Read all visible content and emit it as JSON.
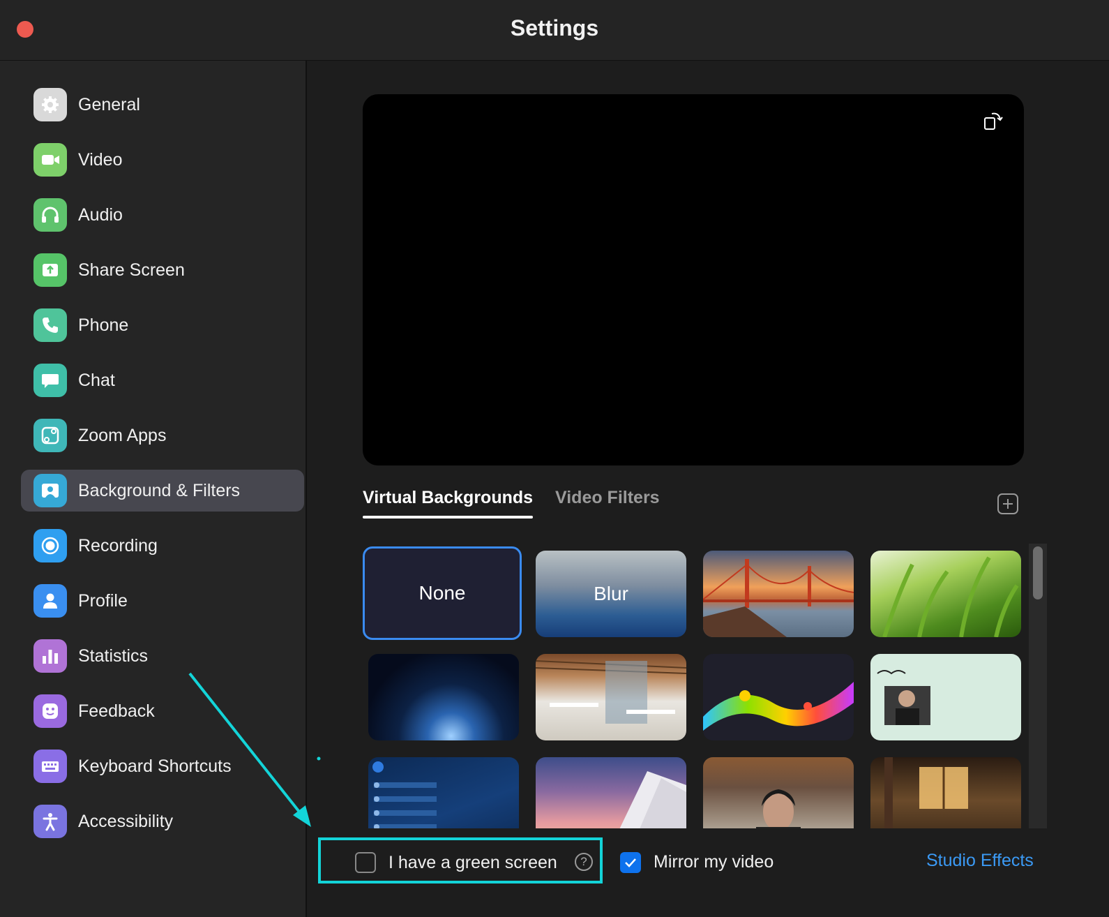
{
  "window": {
    "title": "Settings"
  },
  "sidebar": {
    "items": [
      {
        "label": "General",
        "icon": "gear-icon",
        "color": "#d9d9d9"
      },
      {
        "label": "Video",
        "icon": "video-camera-icon",
        "color": "#7ed06a"
      },
      {
        "label": "Audio",
        "icon": "headphones-icon",
        "color": "#5fc36d"
      },
      {
        "label": "Share Screen",
        "icon": "share-screen-icon",
        "color": "#56c468"
      },
      {
        "label": "Phone",
        "icon": "phone-icon",
        "color": "#4fc49a"
      },
      {
        "label": "Chat",
        "icon": "chat-bubble-icon",
        "color": "#3fbfa8"
      },
      {
        "label": "Zoom Apps",
        "icon": "zoom-apps-icon",
        "color": "#3fb7b8"
      },
      {
        "label": "Background & Filters",
        "icon": "background-person-icon",
        "color": "#36a9d6",
        "active": true
      },
      {
        "label": "Recording",
        "icon": "record-icon",
        "color": "#2f9ff0"
      },
      {
        "label": "Profile",
        "icon": "profile-icon",
        "color": "#3a8ff0"
      },
      {
        "label": "Statistics",
        "icon": "bar-chart-icon",
        "color": "#b073d6"
      },
      {
        "label": "Feedback",
        "icon": "smiley-icon",
        "color": "#9a6ae0"
      },
      {
        "label": "Keyboard Shortcuts",
        "icon": "keyboard-icon",
        "color": "#8a6ee6"
      },
      {
        "label": "Accessibility",
        "icon": "accessibility-icon",
        "color": "#7a74e0"
      }
    ]
  },
  "main": {
    "tabs": [
      {
        "label": "Virtual Backgrounds",
        "active": true
      },
      {
        "label": "Video Filters",
        "active": false
      }
    ],
    "backgrounds": [
      {
        "label": "None",
        "selected": true
      },
      {
        "label": "Blur"
      },
      {
        "name": "golden-gate-bridge"
      },
      {
        "name": "green-grass"
      },
      {
        "name": "earth-from-space"
      },
      {
        "name": "modern-office"
      },
      {
        "name": "diversity-equity-inclusion"
      },
      {
        "name": "arman-profile"
      },
      {
        "name": "zoom-security"
      },
      {
        "name": "sunset-architecture"
      },
      {
        "name": "office-with-person"
      },
      {
        "name": "cozy-room"
      }
    ]
  },
  "footer": {
    "green_screen_label": "I have a green screen",
    "green_screen_checked": false,
    "help_glyph": "?",
    "mirror_label": "Mirror my video",
    "mirror_checked": true,
    "studio_effects_label": "Studio Effects"
  },
  "colors": {
    "accent": "#0e72ed",
    "highlight": "#13d4d8",
    "link": "#3b9af5"
  }
}
